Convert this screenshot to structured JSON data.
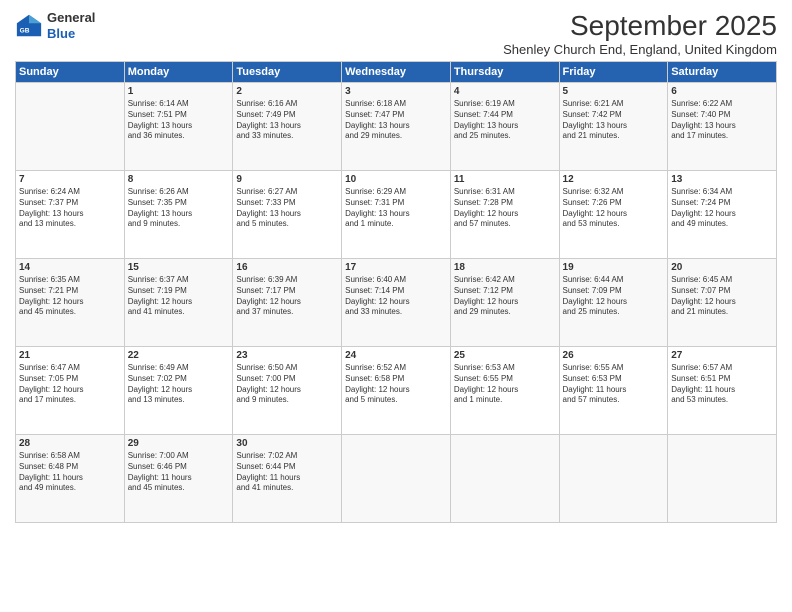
{
  "header": {
    "logo_line1": "General",
    "logo_line2": "Blue",
    "month": "September 2025",
    "location": "Shenley Church End, England, United Kingdom"
  },
  "days_of_week": [
    "Sunday",
    "Monday",
    "Tuesday",
    "Wednesday",
    "Thursday",
    "Friday",
    "Saturday"
  ],
  "weeks": [
    [
      {
        "day": "",
        "content": ""
      },
      {
        "day": "1",
        "content": "Sunrise: 6:14 AM\nSunset: 7:51 PM\nDaylight: 13 hours\nand 36 minutes."
      },
      {
        "day": "2",
        "content": "Sunrise: 6:16 AM\nSunset: 7:49 PM\nDaylight: 13 hours\nand 33 minutes."
      },
      {
        "day": "3",
        "content": "Sunrise: 6:18 AM\nSunset: 7:47 PM\nDaylight: 13 hours\nand 29 minutes."
      },
      {
        "day": "4",
        "content": "Sunrise: 6:19 AM\nSunset: 7:44 PM\nDaylight: 13 hours\nand 25 minutes."
      },
      {
        "day": "5",
        "content": "Sunrise: 6:21 AM\nSunset: 7:42 PM\nDaylight: 13 hours\nand 21 minutes."
      },
      {
        "day": "6",
        "content": "Sunrise: 6:22 AM\nSunset: 7:40 PM\nDaylight: 13 hours\nand 17 minutes."
      }
    ],
    [
      {
        "day": "7",
        "content": "Sunrise: 6:24 AM\nSunset: 7:37 PM\nDaylight: 13 hours\nand 13 minutes."
      },
      {
        "day": "8",
        "content": "Sunrise: 6:26 AM\nSunset: 7:35 PM\nDaylight: 13 hours\nand 9 minutes."
      },
      {
        "day": "9",
        "content": "Sunrise: 6:27 AM\nSunset: 7:33 PM\nDaylight: 13 hours\nand 5 minutes."
      },
      {
        "day": "10",
        "content": "Sunrise: 6:29 AM\nSunset: 7:31 PM\nDaylight: 13 hours\nand 1 minute."
      },
      {
        "day": "11",
        "content": "Sunrise: 6:31 AM\nSunset: 7:28 PM\nDaylight: 12 hours\nand 57 minutes."
      },
      {
        "day": "12",
        "content": "Sunrise: 6:32 AM\nSunset: 7:26 PM\nDaylight: 12 hours\nand 53 minutes."
      },
      {
        "day": "13",
        "content": "Sunrise: 6:34 AM\nSunset: 7:24 PM\nDaylight: 12 hours\nand 49 minutes."
      }
    ],
    [
      {
        "day": "14",
        "content": "Sunrise: 6:35 AM\nSunset: 7:21 PM\nDaylight: 12 hours\nand 45 minutes."
      },
      {
        "day": "15",
        "content": "Sunrise: 6:37 AM\nSunset: 7:19 PM\nDaylight: 12 hours\nand 41 minutes."
      },
      {
        "day": "16",
        "content": "Sunrise: 6:39 AM\nSunset: 7:17 PM\nDaylight: 12 hours\nand 37 minutes."
      },
      {
        "day": "17",
        "content": "Sunrise: 6:40 AM\nSunset: 7:14 PM\nDaylight: 12 hours\nand 33 minutes."
      },
      {
        "day": "18",
        "content": "Sunrise: 6:42 AM\nSunset: 7:12 PM\nDaylight: 12 hours\nand 29 minutes."
      },
      {
        "day": "19",
        "content": "Sunrise: 6:44 AM\nSunset: 7:09 PM\nDaylight: 12 hours\nand 25 minutes."
      },
      {
        "day": "20",
        "content": "Sunrise: 6:45 AM\nSunset: 7:07 PM\nDaylight: 12 hours\nand 21 minutes."
      }
    ],
    [
      {
        "day": "21",
        "content": "Sunrise: 6:47 AM\nSunset: 7:05 PM\nDaylight: 12 hours\nand 17 minutes."
      },
      {
        "day": "22",
        "content": "Sunrise: 6:49 AM\nSunset: 7:02 PM\nDaylight: 12 hours\nand 13 minutes."
      },
      {
        "day": "23",
        "content": "Sunrise: 6:50 AM\nSunset: 7:00 PM\nDaylight: 12 hours\nand 9 minutes."
      },
      {
        "day": "24",
        "content": "Sunrise: 6:52 AM\nSunset: 6:58 PM\nDaylight: 12 hours\nand 5 minutes."
      },
      {
        "day": "25",
        "content": "Sunrise: 6:53 AM\nSunset: 6:55 PM\nDaylight: 12 hours\nand 1 minute."
      },
      {
        "day": "26",
        "content": "Sunrise: 6:55 AM\nSunset: 6:53 PM\nDaylight: 11 hours\nand 57 minutes."
      },
      {
        "day": "27",
        "content": "Sunrise: 6:57 AM\nSunset: 6:51 PM\nDaylight: 11 hours\nand 53 minutes."
      }
    ],
    [
      {
        "day": "28",
        "content": "Sunrise: 6:58 AM\nSunset: 6:48 PM\nDaylight: 11 hours\nand 49 minutes."
      },
      {
        "day": "29",
        "content": "Sunrise: 7:00 AM\nSunset: 6:46 PM\nDaylight: 11 hours\nand 45 minutes."
      },
      {
        "day": "30",
        "content": "Sunrise: 7:02 AM\nSunset: 6:44 PM\nDaylight: 11 hours\nand 41 minutes."
      },
      {
        "day": "",
        "content": ""
      },
      {
        "day": "",
        "content": ""
      },
      {
        "day": "",
        "content": ""
      },
      {
        "day": "",
        "content": ""
      }
    ]
  ]
}
